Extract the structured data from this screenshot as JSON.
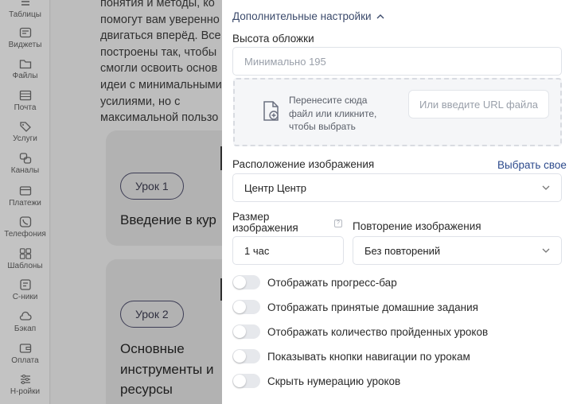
{
  "sidebar": {
    "items": [
      {
        "label": "Таблицы",
        "icon": "table-icon"
      },
      {
        "label": "Виджеты",
        "icon": "widget-icon"
      },
      {
        "label": "Файлы",
        "icon": "folder-icon"
      },
      {
        "label": "Почта",
        "icon": "mail-icon"
      },
      {
        "label": "Услуги",
        "icon": "tag-icon"
      },
      {
        "label": "Каналы",
        "icon": "channels-icon"
      },
      {
        "label": "Платежи",
        "icon": "card-icon"
      },
      {
        "label": "Телефония",
        "icon": "phone-icon"
      },
      {
        "label": "Шаблоны",
        "icon": "templates-icon"
      },
      {
        "label": "С-ники",
        "icon": "directory-icon"
      },
      {
        "label": "Бэкап",
        "icon": "cloud-icon"
      },
      {
        "label": "Оплата",
        "icon": "wallet-icon"
      },
      {
        "label": "Н-ройки",
        "icon": "settings-sliders-icon"
      }
    ]
  },
  "background": {
    "paragraph_lines": [
      "понятия и методы, ко",
      "помогут вам уверенно",
      "двигаться вперёд. Все",
      "построены так, чтобы",
      "смогли освоить основ",
      "идеи с минимальными",
      "усилиями, но с",
      "максимальной пользо"
    ],
    "lessons": [
      {
        "badge": "Урок 1",
        "title_lines": [
          "Введение в кур"
        ]
      },
      {
        "badge": "Урок 2",
        "title_lines": [
          "Основные",
          "инструменты и",
          "ресурсы"
        ]
      }
    ]
  },
  "panel": {
    "section_title": "Дополнительные настройки",
    "cover_height": {
      "label": "Высота обложки",
      "placeholder": "Минимально 195"
    },
    "dropzone": {
      "text_lines": [
        "Перенесите сюда",
        "файл или кликните,",
        "чтобы выбрать"
      ],
      "url_placeholder": "Или введите URL файла"
    },
    "image_position": {
      "label": "Расположение изображения",
      "link": "Выбрать свое",
      "value": "Центр Центр"
    },
    "image_size": {
      "label_lines": [
        "Размер",
        "изображения"
      ],
      "help": "?",
      "value": "1 час"
    },
    "image_repeat": {
      "label": "Повторение изображения",
      "value": "Без повторений"
    },
    "toggles": [
      {
        "label": "Отображать прогресс-бар",
        "on": false
      },
      {
        "label": "Отображать принятые домашние задания",
        "on": false
      },
      {
        "label": "Отображать количество пройденных уроков",
        "on": false
      },
      {
        "label": "Показывать кнопки навигации по урокам",
        "on": false
      },
      {
        "label": "Скрыть нумерацию уроков",
        "on": false
      }
    ]
  },
  "colors": {
    "overlay_gray": "#bdbdbd",
    "panel_bg": "#ffffff",
    "link_blue": "#2c4a8c",
    "section_title_color": "#3b4a6b",
    "toggle_off": "#e6e8ec"
  }
}
